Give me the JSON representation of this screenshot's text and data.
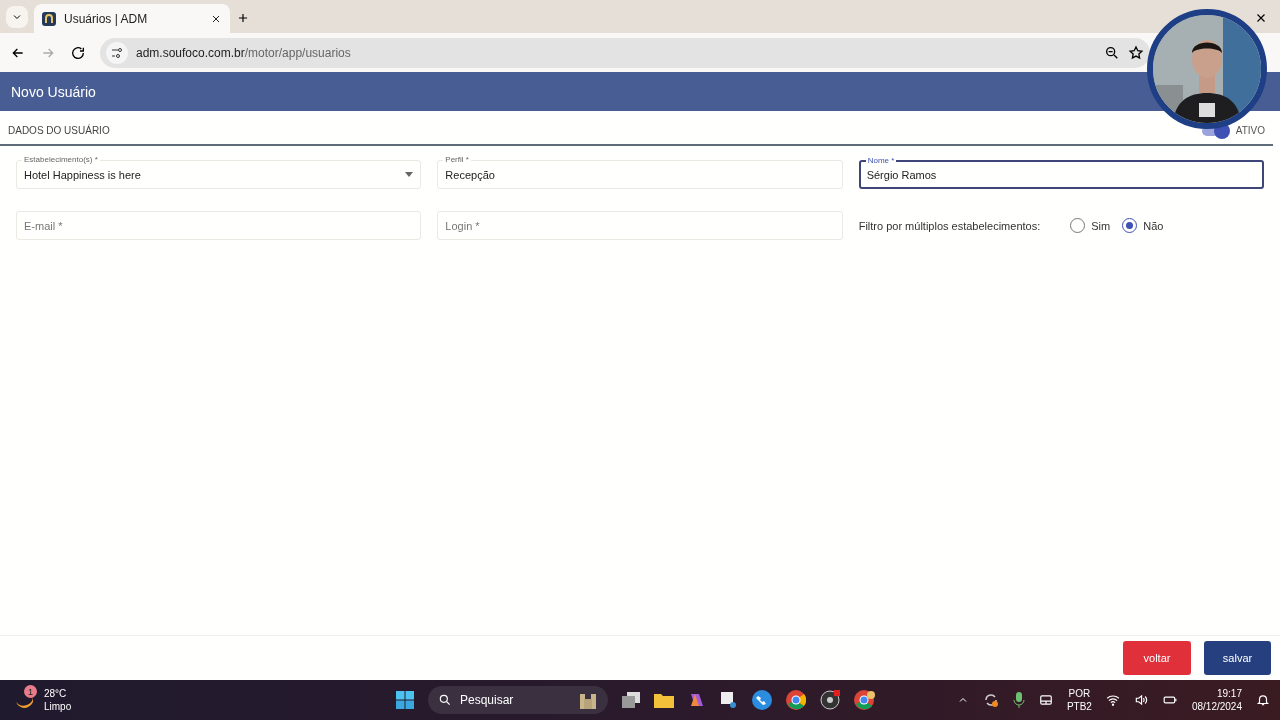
{
  "browser": {
    "tab_title": "Usuários | ADM",
    "url_host": "adm.soufoco.com.br",
    "url_path": "/motor/app/usuarios"
  },
  "header": {
    "title": "Novo Usuário"
  },
  "section": {
    "title": "DADOS DO USUÁRIO",
    "toggle": {
      "label": "ATIVO",
      "on": true
    }
  },
  "fields": [
    {
      "kind": "select",
      "label": "Estabelecimento(s) *",
      "value": "Hotel Happiness is here",
      "focused": false
    },
    {
      "kind": "text",
      "label": "Perfil *",
      "value": "Recepção",
      "focused": false
    },
    {
      "kind": "text",
      "label": "Nome *",
      "value": "Sérgio Ramos",
      "focused": true
    },
    {
      "kind": "text",
      "placeholder": "E-mail *",
      "focused": false
    },
    {
      "kind": "text",
      "placeholder": "Login *",
      "focused": false
    }
  ],
  "radio_group": {
    "label": "Filtro por múltiplos estabelecimentos:",
    "options": [
      {
        "label": "Sim",
        "selected": false
      },
      {
        "label": "Não",
        "selected": true
      }
    ]
  },
  "buttons": [
    {
      "label": "voltar",
      "kind": "danger"
    },
    {
      "label": "salvar",
      "kind": "primary"
    }
  ],
  "taskbar": {
    "weather_badge": "1",
    "temperature": "28°C",
    "condition": "Limpo",
    "search": "Pesquisar",
    "language": "POR",
    "layout": "PTB2",
    "time": "19:17",
    "date": "08/12/2024"
  }
}
